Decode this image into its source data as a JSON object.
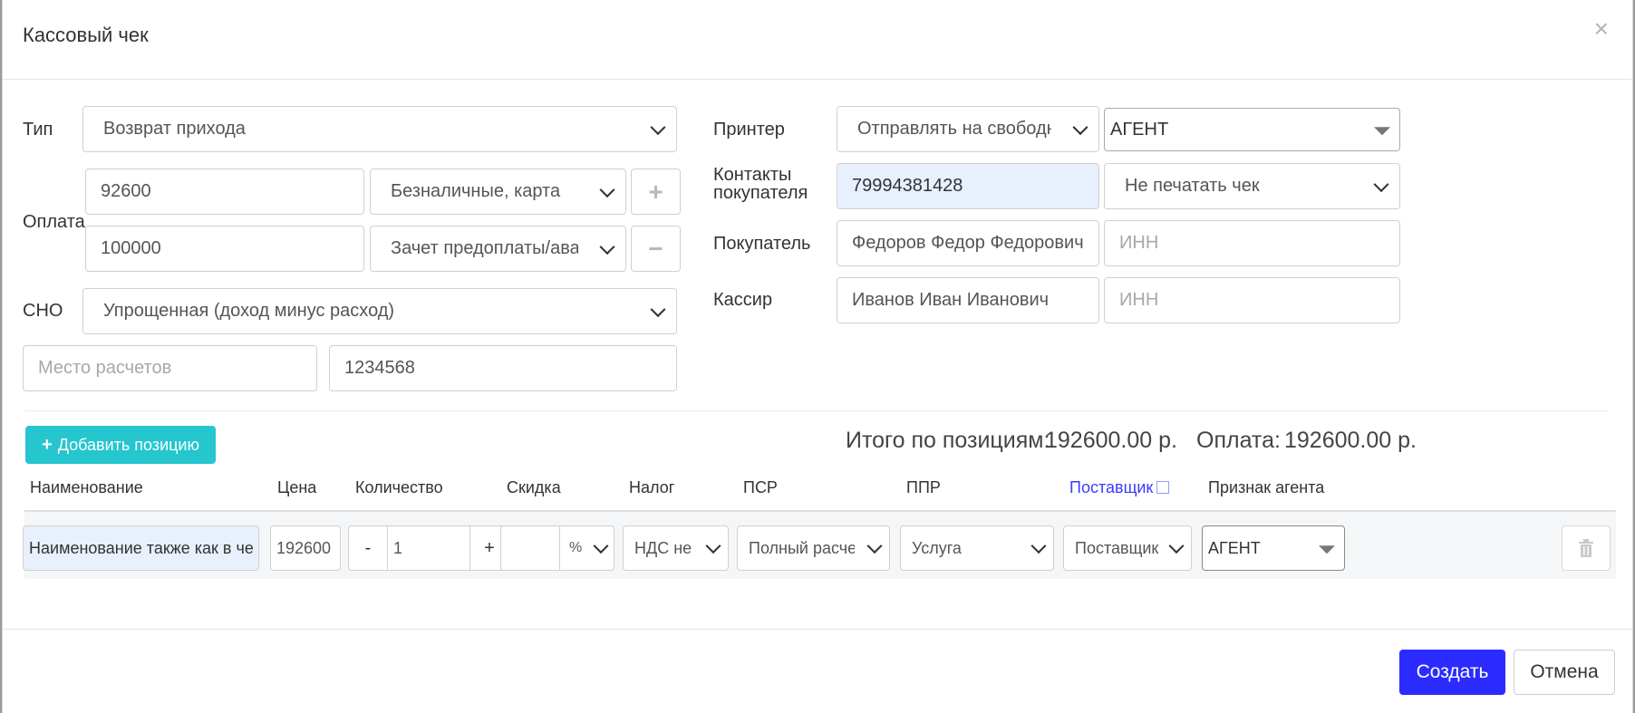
{
  "dialog": {
    "title": "Кассовый чек",
    "close_label": "×"
  },
  "left": {
    "type_label": "Тип",
    "type_value": "Возврат прихода",
    "payment_label": "Оплата",
    "payments": [
      {
        "amount": "92600",
        "method": "Безналичные, карта",
        "button": "+"
      },
      {
        "amount": "100000",
        "method": "Зачет предоплаты/аванса",
        "button": "−"
      }
    ],
    "sno_label": "СНО",
    "sno_value": "Упрощенная (доход минус расход)",
    "place_placeholder": "Место расчетов",
    "place_number": "1234568"
  },
  "right": {
    "printer_label": "Принтер",
    "printer_value": "Отправлять на свободный",
    "agent_value": "АГЕНТ",
    "contacts_label_1": "Контакты",
    "contacts_label_2": "покупателя",
    "contacts_value": "79994381428",
    "print_option": "Не печатать чек",
    "buyer_label": "Покупатель",
    "buyer_value": "Федоров Федор Федорович",
    "buyer_inn_placeholder": "ИНН",
    "cashier_label": "Кассир",
    "cashier_value": "Иванов Иван Иванович",
    "cashier_inn_placeholder": "ИНН"
  },
  "positions": {
    "add_label": "Добавить позицию",
    "total_label": "Итого по позициям:",
    "total_value": "192600.00 р.",
    "paid_label": "Оплата:",
    "paid_value": "192600.00 р.",
    "columns": [
      "Наименование",
      "Цена",
      "Количество",
      "Скидка",
      "Налог",
      "ПСР",
      "ППР",
      "Поставщик",
      "Признак агента"
    ],
    "row": {
      "name": "Наименование также как в чеке",
      "price": "192600",
      "minus": "-",
      "qty": "1",
      "plus": "+",
      "discount": "",
      "discount_unit": "%",
      "tax": "НДС не облагается",
      "psr": "Полный расчет",
      "ppr": "Услуга",
      "supplier": "Поставщик ООО",
      "agent": "АГЕНТ"
    }
  },
  "footer": {
    "create_label": "Создать",
    "cancel_label": "Отмена"
  }
}
